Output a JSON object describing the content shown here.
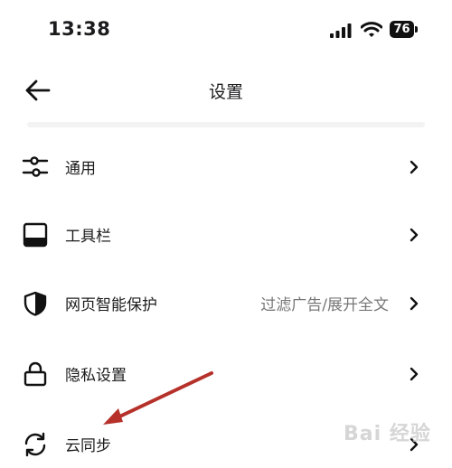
{
  "status_bar": {
    "time": "13:38",
    "battery_level": "76"
  },
  "header": {
    "title": "设置"
  },
  "settings": {
    "general": {
      "label": "通用"
    },
    "toolbar": {
      "label": "工具栏"
    },
    "protection": {
      "label": "网页智能保护",
      "value": "过滤广告/展开全文"
    },
    "privacy": {
      "label": "隐私设置"
    },
    "cloud_sync": {
      "label": "云同步"
    }
  },
  "watermark": {
    "text": "Bai 经验"
  },
  "colors": {
    "annotation_arrow": "#b5312a",
    "text": "#1c1c1e",
    "secondary_text": "#777777"
  }
}
